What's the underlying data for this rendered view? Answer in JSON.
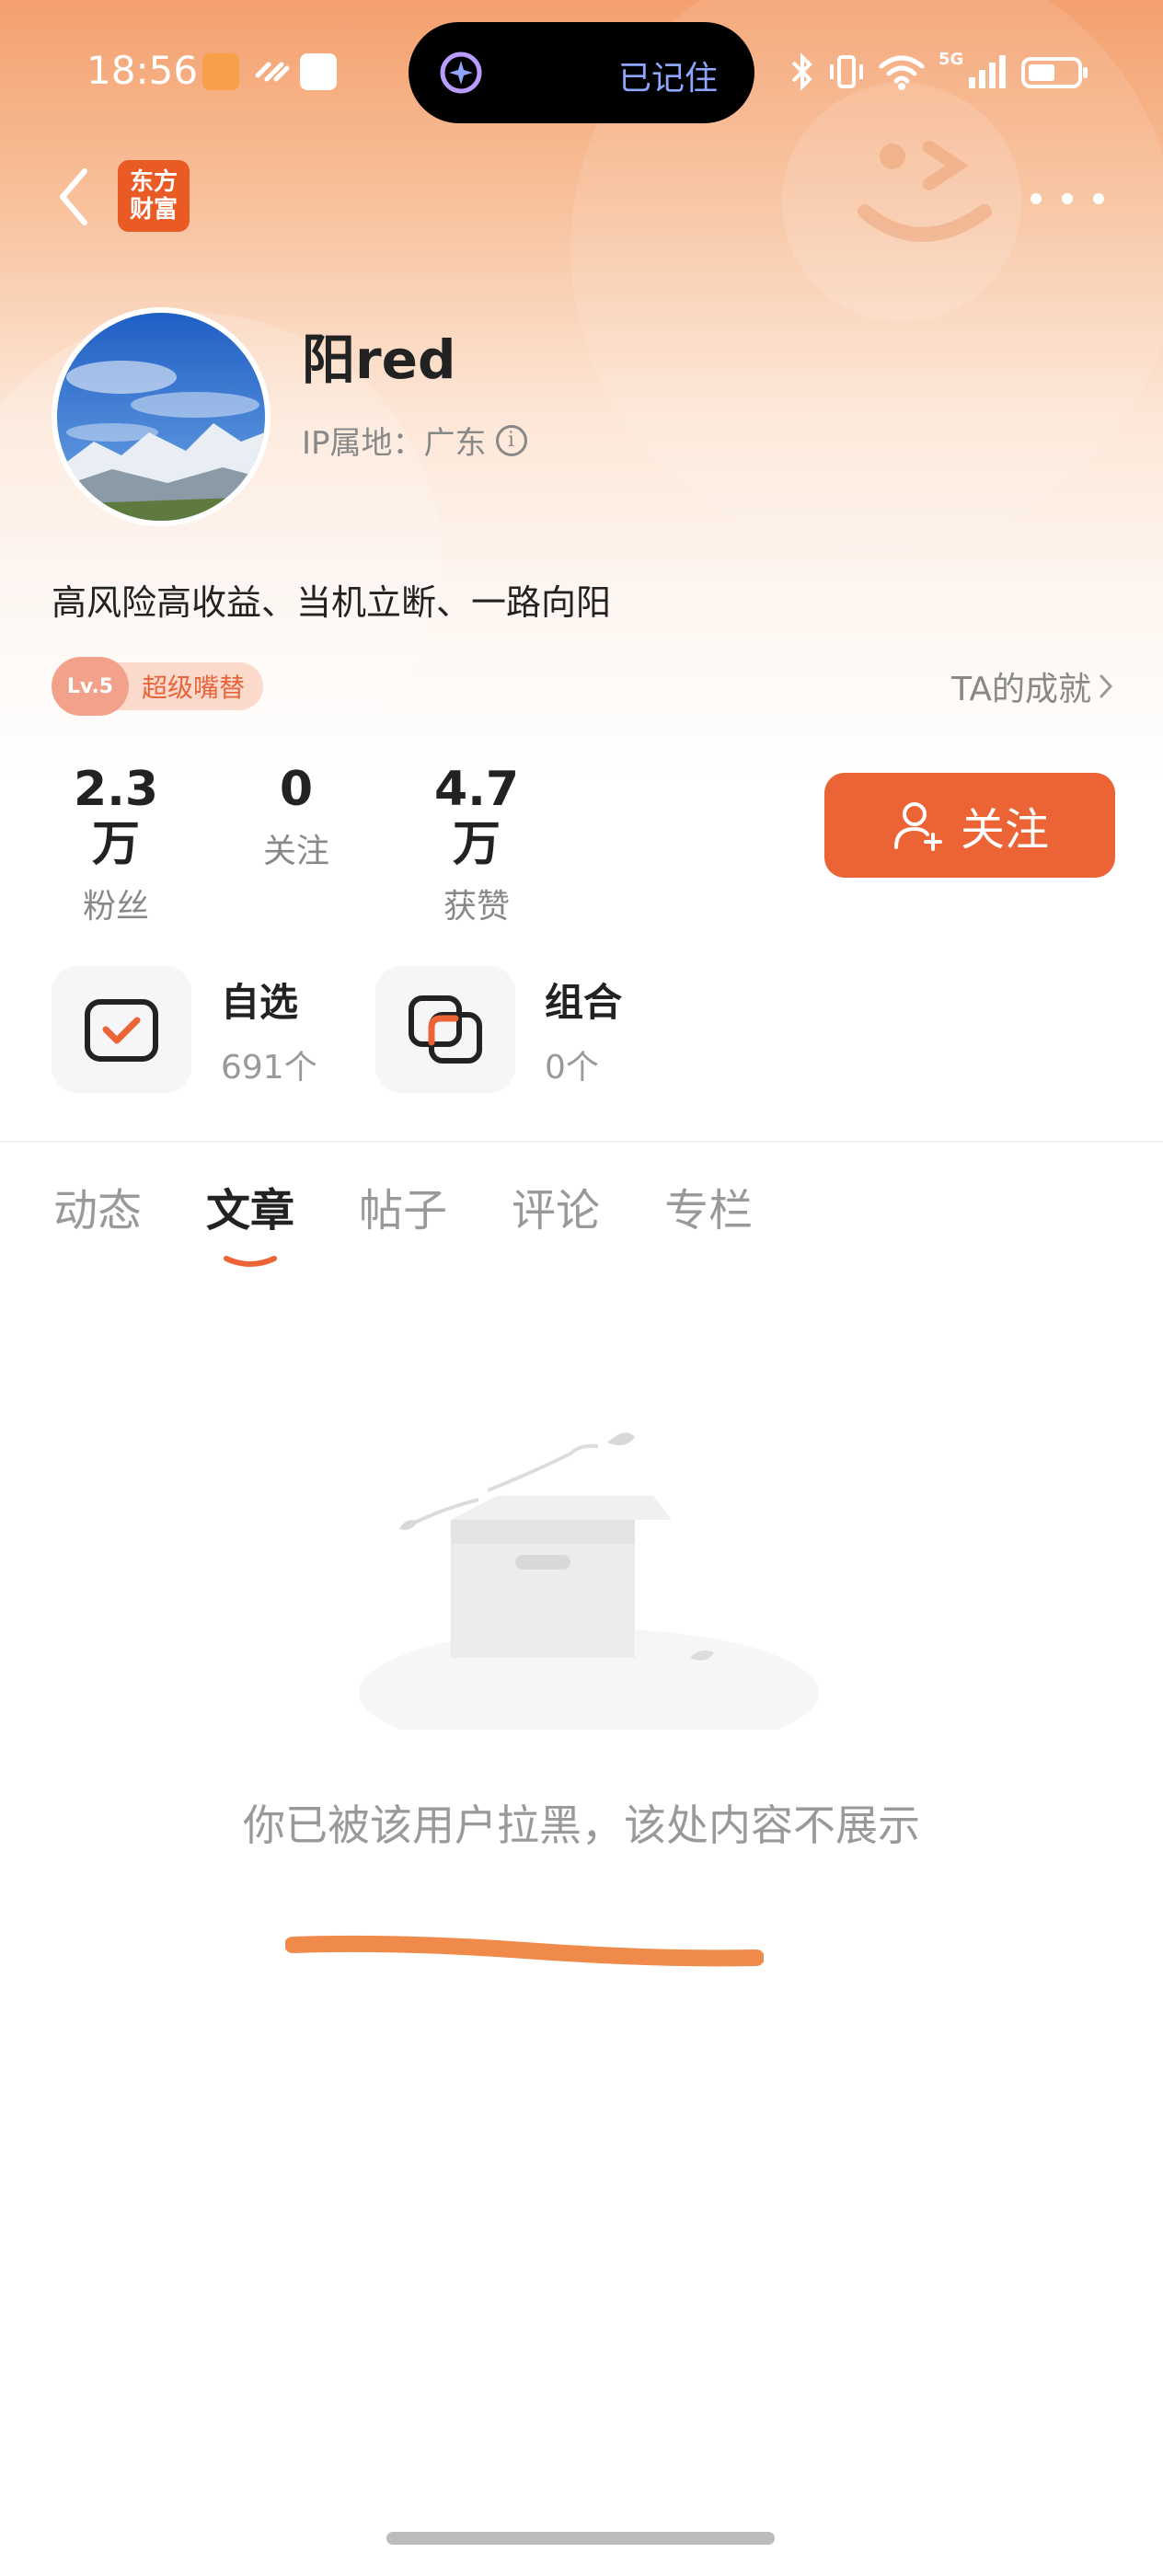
{
  "status_bar": {
    "time": "18:56",
    "island_text": "已记住",
    "network": "5G"
  },
  "nav": {
    "brand_line1": "东方",
    "brand_line2": "财富"
  },
  "profile": {
    "username": "阳red",
    "ip_location": "IP属地：广东",
    "bio": "高风险高收益、当机立断、一路向阳",
    "level": "Lv.5",
    "level_title": "超级嘴替",
    "achievements_label": "TA的成就"
  },
  "stats": [
    {
      "value": "2.3万",
      "label": "粉丝"
    },
    {
      "value": "0",
      "label": "关注"
    },
    {
      "value": "4.7万",
      "label": "获赞"
    }
  ],
  "follow_button": "关注",
  "tools": [
    {
      "title": "自选",
      "count": "691个"
    },
    {
      "title": "组合",
      "count": "0个"
    }
  ],
  "tabs": [
    "动态",
    "文章",
    "帖子",
    "评论",
    "专栏"
  ],
  "active_tab": "文章",
  "empty_message": "你已被该用户拉黑，该处内容不展示",
  "colors": {
    "accent": "#ec6435",
    "brand": "#ea5a24",
    "text_secondary": "#999999",
    "highlight_stroke": "#f08a4b"
  }
}
